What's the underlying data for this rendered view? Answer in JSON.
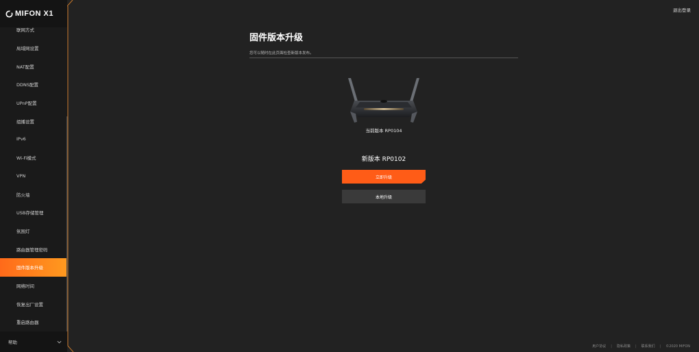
{
  "brand": {
    "name": "MIFON X1"
  },
  "sidebar": {
    "items": [
      {
        "label": "联网方式"
      },
      {
        "label": "局域网设置"
      },
      {
        "label": "NAT配置"
      },
      {
        "label": "DDNS配置"
      },
      {
        "label": "UPnP配置"
      },
      {
        "label": "组播设置"
      },
      {
        "label": "IPv6"
      },
      {
        "label": "Wi-Fi模式"
      },
      {
        "label": "VPN"
      },
      {
        "label": "防火墙"
      },
      {
        "label": "USB存储管理"
      },
      {
        "label": "氛围灯"
      },
      {
        "label": "路由器管理密码"
      },
      {
        "label": "固件版本升级",
        "active": true
      },
      {
        "label": "网络时间"
      },
      {
        "label": "恢复出厂设置"
      },
      {
        "label": "重启路由器"
      }
    ],
    "help_label": "帮助"
  },
  "header": {
    "logout_label": "退出登录"
  },
  "main": {
    "title": "固件版本升级",
    "subtitle": "您可以随时在此页面检查新版本发布。",
    "current_version": "当前版本 RP0104",
    "new_version": "新版本 RP0102",
    "upgrade_now_label": "立即升级",
    "local_upgrade_label": "本地升级"
  },
  "footer": {
    "user_agreement": "用户协议",
    "privacy_policy": "隐私政策",
    "contact_us": "联系我们",
    "copyright": "©2020 MIFON"
  },
  "colors": {
    "accent": "#ff5c17",
    "accent_gradient_end": "#ff9a1f",
    "background": "#222222",
    "sidebar": "#1a1a1a"
  },
  "icons": {
    "logo": "mifon-logo-icon",
    "help_toggle": "chevron-down-icon",
    "router": "router-image"
  }
}
